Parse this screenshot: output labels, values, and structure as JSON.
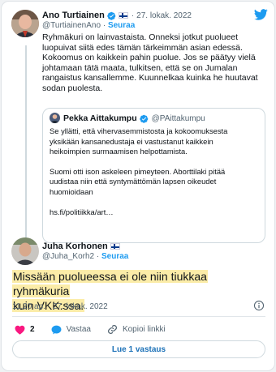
{
  "main_tweet": {
    "author_name": "Ano Turtiainen",
    "handle": "@TurtiainenAno",
    "date": "27. lokak. 2022",
    "follow_label": "Seuraa",
    "separator": "·",
    "lines": [
      "Ryhmäkuri on lainvastaista. Onneksi jotkut puolueet",
      "luopuivat siitä edes tämän tärkeimmän asian edessä.",
      "Kokoomus on kaikkein pahin puolue. Jos se päätyy vielä",
      "johtamaan tätä maata, tulkitsen, että se on Jumalan",
      "rangaistus kansallemme. Kuunnelkaa kuinka he huutavat",
      "sodan puolesta."
    ]
  },
  "quoted_tweet": {
    "author_name": "Pekka Aittakumpu",
    "handle": "@PAittakumpu",
    "paragraph1": [
      "Se yllätti, että vihervasemmistosta ja kokoomuksesta",
      "yksikään kansanedustaja ei vastustanut kaikkein",
      "heikoimpien surmaamisen helpottamista."
    ],
    "paragraph2": [
      "Suomi otti ison askeleen pimeyteen. Aborttilaki pitää",
      "uudistaa niin että syntymättömän lapsen oikeudet",
      "huomioidaan"
    ],
    "link": "hs.fi/politiikka/art…"
  },
  "reply_tweet": {
    "author_name": "Juha Korhonen",
    "handle": "@Juha_Korh2",
    "follow_label": "Seuraa",
    "separator": "·",
    "lines": [
      "Missään puolueessa ei ole niin tiukkaa ryhmäkuria",
      "kuin VKK:ssa."
    ],
    "timestamp": "11.20 ap. · 27. lokak. 2022"
  },
  "actions": {
    "like_count": "2",
    "reply_label": "Vastaa",
    "copy_link_label": "Kopioi linkki"
  },
  "read_replies_label": "Lue 1 vastaus",
  "colors": {
    "accent": "#1d9bf0",
    "like": "#f91880",
    "highlight": "#fbeca8"
  },
  "icons": [
    "twitter-bird-icon",
    "verified-badge-icon",
    "finnish-flag-icon",
    "info-icon",
    "heart-icon",
    "reply-bubble-icon",
    "link-icon"
  ]
}
